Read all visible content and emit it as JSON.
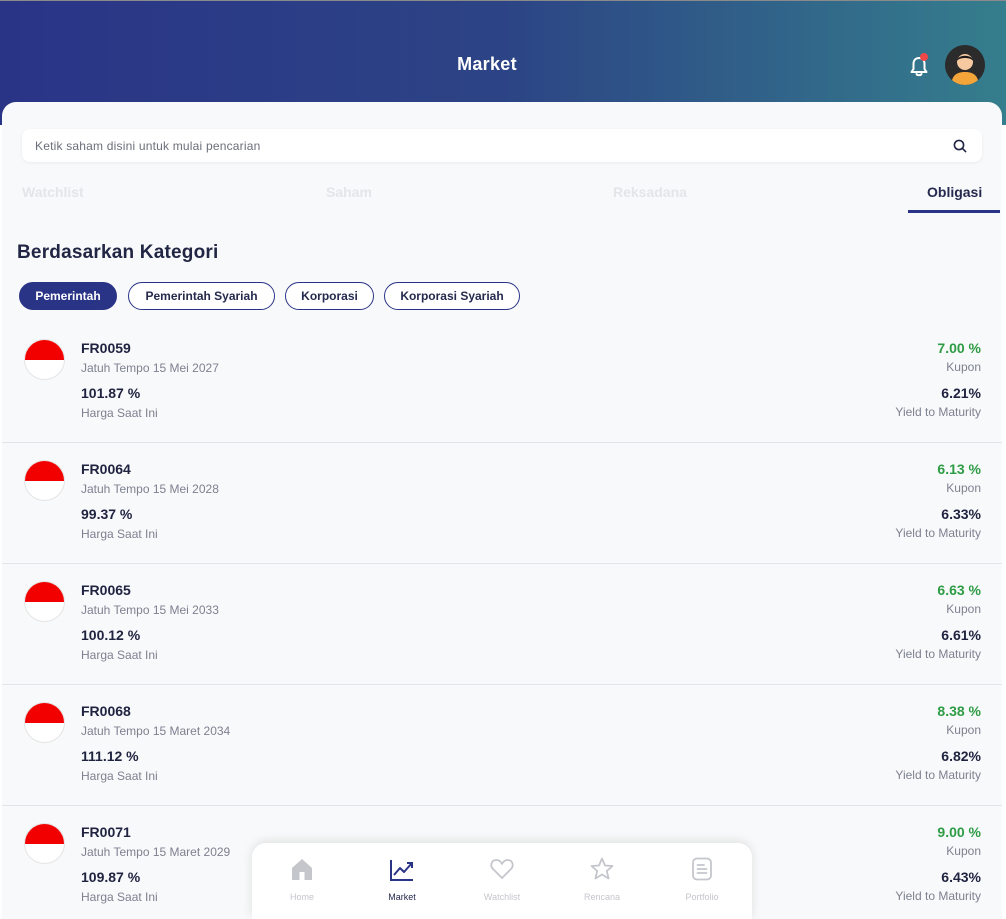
{
  "header": {
    "title": "Market"
  },
  "search": {
    "placeholder": "Ketik saham disini untuk mulai pencarian"
  },
  "tabs": [
    {
      "label": "Watchlist"
    },
    {
      "label": "Saham"
    },
    {
      "label": "Reksadana"
    },
    {
      "label": "Obligasi",
      "active": true
    }
  ],
  "section": {
    "title": "Berdasarkan Kategori"
  },
  "categories": [
    {
      "label": "Pemerintah",
      "active": true
    },
    {
      "label": "Pemerintah Syariah"
    },
    {
      "label": "Korporasi"
    },
    {
      "label": "Korporasi Syariah"
    }
  ],
  "labels": {
    "price": "Harga Saat Ini",
    "coupon": "Kupon",
    "ytm": "Yield to Maturity"
  },
  "bonds": [
    {
      "code": "FR0059",
      "due": "Jatuh Tempo 15 Mei 2027",
      "price": "101.87 %",
      "coupon": "7.00 %",
      "ytm": "6.21%"
    },
    {
      "code": "FR0064",
      "due": "Jatuh Tempo 15 Mei 2028",
      "price": "99.37 %",
      "coupon": "6.13 %",
      "ytm": "6.33%"
    },
    {
      "code": "FR0065",
      "due": "Jatuh Tempo 15 Mei 2033",
      "price": "100.12 %",
      "coupon": "6.63 %",
      "ytm": "6.61%"
    },
    {
      "code": "FR0068",
      "due": "Jatuh Tempo 15 Maret 2034",
      "price": "111.12 %",
      "coupon": "8.38 %",
      "ytm": "6.82%"
    },
    {
      "code": "FR0071",
      "due": "Jatuh Tempo 15 Maret 2029",
      "price": "109.87 %",
      "coupon": "9.00 %",
      "ytm": "6.43%"
    }
  ],
  "nav": [
    {
      "label": "Home",
      "icon": "home-icon"
    },
    {
      "label": "Market",
      "icon": "chart-icon",
      "active": true
    },
    {
      "label": "Watchlist",
      "icon": "heart-icon"
    },
    {
      "label": "Rencana",
      "icon": "star-icon"
    },
    {
      "label": "Portfolio",
      "icon": "document-icon"
    }
  ],
  "colors": {
    "primary": "#2a3487",
    "positive": "#2e9c45",
    "notification": "#f04848",
    "flag_red": "#f20000"
  }
}
